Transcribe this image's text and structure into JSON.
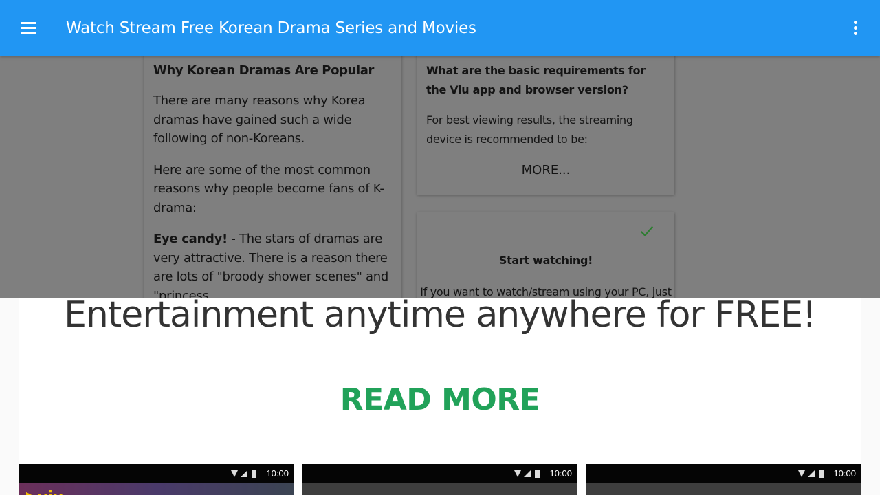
{
  "appbar": {
    "title": "Watch Stream Free Korean Drama Series and Movies",
    "menu_icon": "hamburger-menu-icon",
    "overflow_icon": "more-vert-icon",
    "color": "#2196f3"
  },
  "popular_card": {
    "heading": "Why Korean Dramas Are Popular",
    "para1": "There are many reasons why Korea dramas have gained such a wide following of non-Koreans.",
    "para2": "Here are some of the most common reasons why people become fans of K-drama:",
    "para3_bold": "Eye candy!",
    "para3_rest": " - The stars of dramas are very attractive. There is a reason there are lots of \"broody shower scenes\" and \"princess"
  },
  "requirements_card": {
    "question": "What are the basic requirements for the Viu app and browser version?",
    "answer": "For best viewing results, the streaming device is recommended to be:",
    "more_label": "MORE..."
  },
  "start_card": {
    "check_icon": "checkmark-icon",
    "title": "Start watching!",
    "text": "If you want to watch/stream using your PC, just"
  },
  "promo": {
    "headline": "Entertainment anytime anywhere for FREE!",
    "read_more": "READ MORE",
    "read_more_color": "#21a259"
  },
  "screenshots": [
    {
      "time": "10:00"
    },
    {
      "time": "10:00"
    },
    {
      "time": "10:00"
    }
  ]
}
